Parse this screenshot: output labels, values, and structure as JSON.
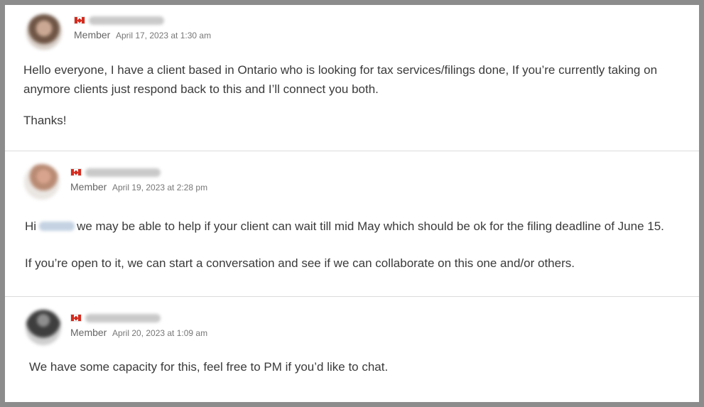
{
  "posts": [
    {
      "role": "Member",
      "date": "April 17, 2023 at 1:30 am",
      "body_line1": "Hello everyone, I have a client based in Ontario who is looking for tax services/filings done, If you’re currently taking on",
      "body_line2": "anymore clients just respond back to this and I’ll connect you both.",
      "body_line3": "Thanks!"
    },
    {
      "role": "Member",
      "date": "April 19, 2023 at 2:28 pm",
      "body_prefix": "Hi",
      "body_line1_rest": "we may be able to help if your client can wait till mid May which should be ok for the filing deadline of June 15.",
      "body_line2": "If you’re open to it, we can start a conversation and see if we can collaborate on this one and/or others."
    },
    {
      "role": "Member",
      "date": "April 20, 2023 at 1:09 am",
      "body_line1": "We have some capacity for this, feel free to PM if you’d like to chat."
    }
  ],
  "colors": {
    "flag_red": "#d52b1e",
    "divider": "#dcdcdc",
    "frame_border": "#8c8c8c"
  },
  "icons": [
    "canada-flag-icon",
    "avatar"
  ]
}
